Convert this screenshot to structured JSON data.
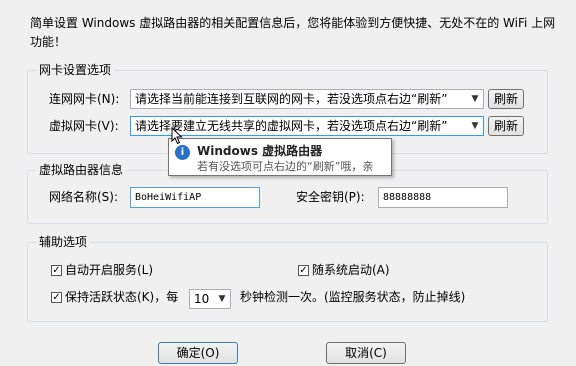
{
  "intro": "简单设置 Windows 虚拟路由器的相关配置信息后，您将能体验到方便快捷、无处不在的 WiFi 上网功能！",
  "nic_group": {
    "title": "网卡设置选项",
    "internet_nic": {
      "label": "连网网卡(N):",
      "value": "请选择当前能连接到互联网的网卡，若没选项点右边“刷新”",
      "refresh_label": "刷新"
    },
    "virtual_nic": {
      "label": "虚拟网卡(V):",
      "value": "请选择要建立无线共享的虚拟网卡，若没选项点右边“刷新”",
      "refresh_label": "刷新"
    }
  },
  "tooltip": {
    "title": "Windows 虚拟路由器",
    "body": "若有没选项可点右边的“刷新”哦，亲",
    "icon": "info-icon"
  },
  "router_group": {
    "title": "虚拟路由器信息",
    "ssid_label": "网络名称(S):",
    "ssid_value": "BoHeiWifiAP",
    "key_label": "安全密钥(P):",
    "key_value": "88888888"
  },
  "aux_group": {
    "title": "辅助选项",
    "auto_start": {
      "label": "自动开启服务(L)",
      "checked": true
    },
    "start_with_system": {
      "label": "随系统启动(A)",
      "checked": true
    },
    "keep_alive": {
      "label": "保持活跃状态(K)，每",
      "interval": "10",
      "suffix": "秒钟检测一次。(监控服务状态，防止掉线)",
      "checked": true
    }
  },
  "buttons": {
    "ok": "确定(O)",
    "cancel": "取消(C)"
  },
  "check_mark": "✓",
  "colors": {
    "group_border": "#d5dfe5",
    "focus_border": "#3399ff",
    "tooltip_icon": "#2d6fc8"
  }
}
